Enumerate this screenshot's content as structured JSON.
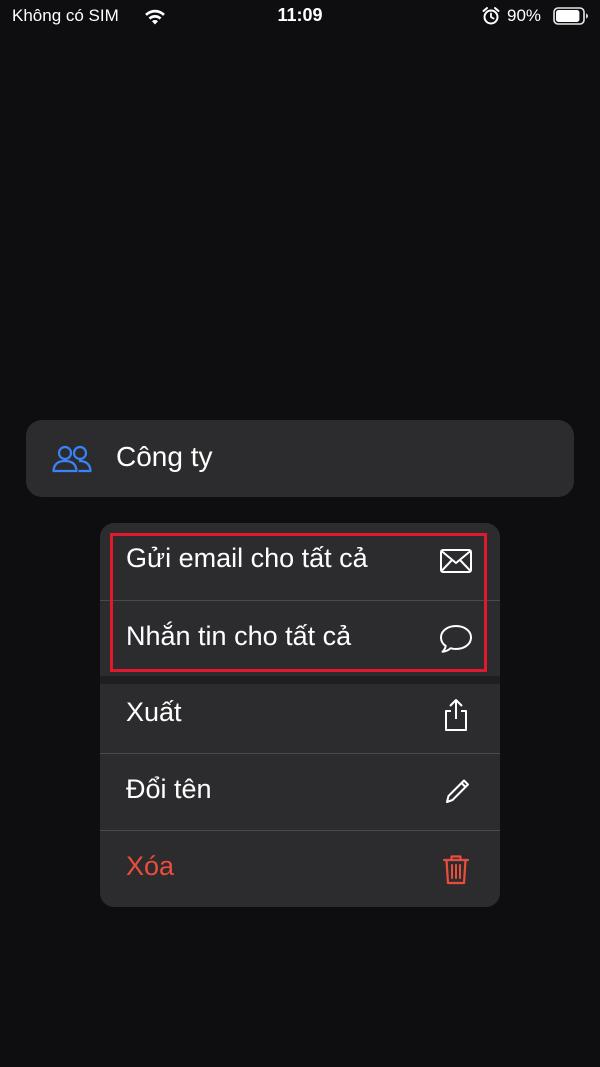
{
  "status_bar": {
    "carrier": "Không có SIM",
    "time": "11:09",
    "battery_percent": "90%",
    "battery_level": 0.9,
    "icons": [
      "wifi-icon",
      "alarm-icon",
      "battery-icon"
    ]
  },
  "group": {
    "name": "Công ty",
    "icon": "people-icon",
    "icon_color": "#3a82f7"
  },
  "menu": {
    "items": [
      {
        "label": "Gửi email cho tất cả",
        "icon": "envelope-icon"
      },
      {
        "label": "Nhắn tin cho tất cả",
        "icon": "message-bubble-icon"
      },
      {
        "label": "Xuất",
        "icon": "share-icon"
      },
      {
        "label": "Đổi tên",
        "icon": "pencil-icon"
      },
      {
        "label": "Xóa",
        "icon": "trash-icon",
        "destructive": true
      }
    ]
  },
  "colors": {
    "background": "#0e0e10",
    "card": "#2c2c2e",
    "text": "#ffffff",
    "destructive": "#eb4d3d",
    "highlight": "#e0192c"
  }
}
